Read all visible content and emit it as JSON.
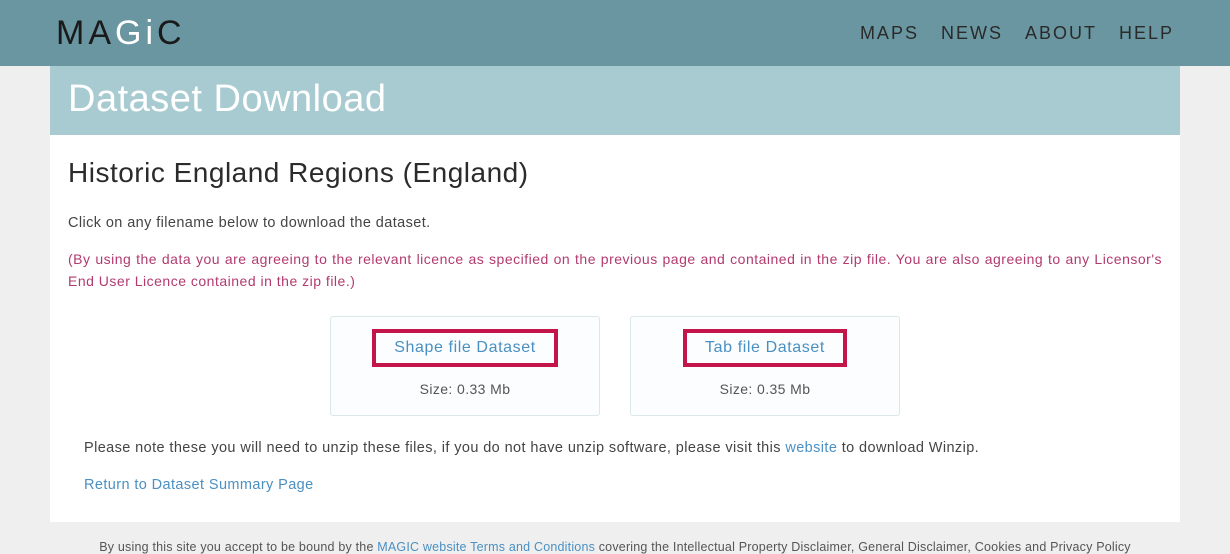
{
  "header": {
    "logo": {
      "text": "MAGiC"
    },
    "nav": [
      {
        "label": "MAPS"
      },
      {
        "label": "NEWS"
      },
      {
        "label": "ABOUT"
      },
      {
        "label": "HELP"
      }
    ]
  },
  "page": {
    "title": "Dataset Download",
    "heading": "Historic England Regions (England)",
    "intro": "Click on any filename below to download the dataset.",
    "license": "(By using the data you are agreeing to the relevant licence as specified on the previous page and contained in the zip file. You are also agreeing to any Licensor's End User Licence contained in the zip file.)"
  },
  "downloads": [
    {
      "label": "Shape file Dataset",
      "size": "Size: 0.33 Mb"
    },
    {
      "label": "Tab file Dataset",
      "size": "Size: 0.35 Mb"
    }
  ],
  "note": {
    "prefix": "Please note these you will need to unzip these files, if you do not have unzip software, please visit this ",
    "link_text": "website",
    "suffix": " to download Winzip."
  },
  "return_link": "Return to Dataset Summary Page",
  "footer": {
    "prefix": "By using this site you accept to be bound by the ",
    "link_text": "MAGIC website Terms and Conditions",
    "suffix": " covering the Intellectual Property Disclaimer, General Disclaimer, Cookies and Privacy Policy"
  }
}
